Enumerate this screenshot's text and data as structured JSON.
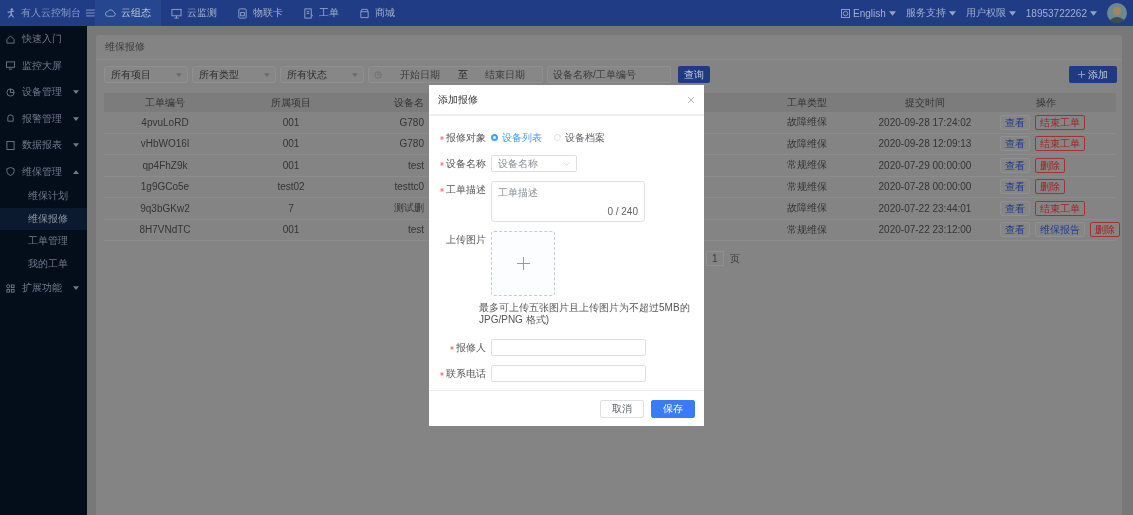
{
  "topbar": {
    "brand": "有人云控制台",
    "nav": [
      {
        "label": "云组态",
        "selected": true
      },
      {
        "label": "云监测",
        "selected": false
      },
      {
        "label": "物联卡",
        "selected": false
      },
      {
        "label": "工单",
        "selected": false
      },
      {
        "label": "商城",
        "selected": false
      }
    ],
    "menus": [
      {
        "label": "English"
      },
      {
        "label": "服务支持"
      },
      {
        "label": "用户权限"
      },
      {
        "label": "18953722262"
      }
    ]
  },
  "sidebar": {
    "items": [
      {
        "label": "快速入门"
      },
      {
        "label": "监控大屏"
      },
      {
        "label": "设备管理",
        "expanded": false
      },
      {
        "label": "报警管理",
        "expanded": false
      },
      {
        "label": "数据报表",
        "expanded": false
      },
      {
        "label": "维保管理",
        "expanded": true,
        "children": [
          {
            "label": "维保计划",
            "selected": false
          },
          {
            "label": "维保报修",
            "selected": true
          },
          {
            "label": "工单管理",
            "selected": false
          },
          {
            "label": "我的工单",
            "selected": false
          }
        ]
      },
      {
        "label": "扩展功能",
        "expanded": false
      }
    ]
  },
  "page": {
    "title": "维保报修",
    "filters": {
      "selects": [
        "所有项目",
        "所有类型",
        "所有状态"
      ],
      "start_placeholder": "开始日期",
      "range_separator": "至",
      "end_placeholder": "结束日期",
      "search_placeholder": "设备名称/工单编号",
      "query_button": "查询"
    },
    "add_button": "添加",
    "table": {
      "columns": [
        "工单编号",
        "所属项目",
        "设备名",
        "工单类型",
        "提交时间",
        "操作"
      ],
      "rows": [
        {
          "id": "4pvuLoRD",
          "project": "001",
          "device": "G780",
          "type": "故障维保",
          "time": "2020-09-28 17:24:02",
          "actions": [
            {
              "label": "查看",
              "kind": "view"
            },
            {
              "label": "结束工单",
              "kind": "danger"
            }
          ]
        },
        {
          "id": "vHbWO16l",
          "project": "001",
          "device": "G780",
          "type": "故障维保",
          "time": "2020-09-28 12:09:13",
          "actions": [
            {
              "label": "查看",
              "kind": "view"
            },
            {
              "label": "结束工单",
              "kind": "danger"
            }
          ]
        },
        {
          "id": "qp4FhZ9k",
          "project": "001",
          "device": "test",
          "type": "常规维保",
          "time": "2020-07-29 00:00:00",
          "actions": [
            {
              "label": "查看",
              "kind": "view"
            },
            {
              "label": "删除",
              "kind": "danger"
            }
          ]
        },
        {
          "id": "1g9GCo5e",
          "project": "test02",
          "device": "testtc0",
          "type": "常规维保",
          "time": "2020-07-28 00:00:00",
          "actions": [
            {
              "label": "查看",
              "kind": "view"
            },
            {
              "label": "删除",
              "kind": "danger"
            }
          ]
        },
        {
          "id": "9q3bGKw2",
          "project": "7",
          "device": "测试删",
          "type": "故障维保",
          "time": "2020-07-22 23:44:01",
          "actions": [
            {
              "label": "查看",
              "kind": "view"
            },
            {
              "label": "结束工单",
              "kind": "danger"
            }
          ]
        },
        {
          "id": "8H7VNdTC",
          "project": "001",
          "device": "test",
          "type": "常规维保",
          "time": "2020-07-22 23:12:00",
          "actions": [
            {
              "label": "查看",
              "kind": "view"
            },
            {
              "label": "维保报告",
              "kind": "report"
            },
            {
              "label": "删除",
              "kind": "danger"
            }
          ]
        }
      ]
    },
    "pager": {
      "page": "1",
      "unit": "页"
    }
  },
  "dialog": {
    "title": "添加报修",
    "fields": [
      {
        "kind": "radio",
        "label": "报修对象",
        "required": true,
        "options": [
          {
            "label": "设备列表",
            "selected": true
          },
          {
            "label": "设备档案",
            "selected": false
          }
        ]
      },
      {
        "kind": "select",
        "label": "设备名称",
        "required": true,
        "placeholder": "设备名称"
      },
      {
        "kind": "textarea",
        "label": "工单描述",
        "required": true,
        "placeholder": "工单描述",
        "counter": "0 / 240"
      },
      {
        "kind": "upload",
        "label": "上传图片",
        "required": false,
        "hint": "最多可上传五张图片且上传图片为不超过5MB的 JPG/PNG 格式)"
      },
      {
        "kind": "text",
        "label": "报修人",
        "required": true
      },
      {
        "kind": "text",
        "label": "联系电话",
        "required": true
      }
    ],
    "buttons": [
      {
        "label": "取消",
        "kind": "default"
      },
      {
        "label": "保存",
        "kind": "primary"
      }
    ]
  }
}
